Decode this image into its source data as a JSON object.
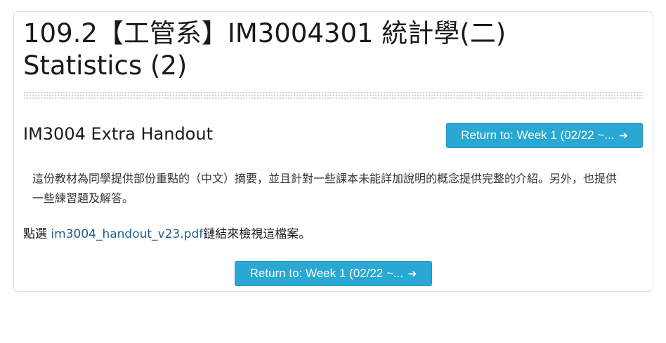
{
  "course": {
    "title_line1": "109.2【工管系】IM3004301 統計學(二)",
    "title_line2": "Statistics (2)"
  },
  "activity": {
    "title": "IM3004 Extra Handout",
    "intro": "這份教材為同學提供部份重點的（中文）摘要，並且針對一些課本未能詳加說明的概念提供完整的介紹。另外，也提供一些練習題及解答。",
    "file_prefix": "點選 ",
    "file_name": "im3004_handout_v23.pdf",
    "file_suffix": "鏈結來檢視這檔案。"
  },
  "navigation": {
    "return_label": "Return to: Week 1 (02/22 ~...",
    "return_icon": "sign-in-icon"
  },
  "colors": {
    "button_bg": "#29a8d3",
    "link": "#1f5f8b"
  }
}
